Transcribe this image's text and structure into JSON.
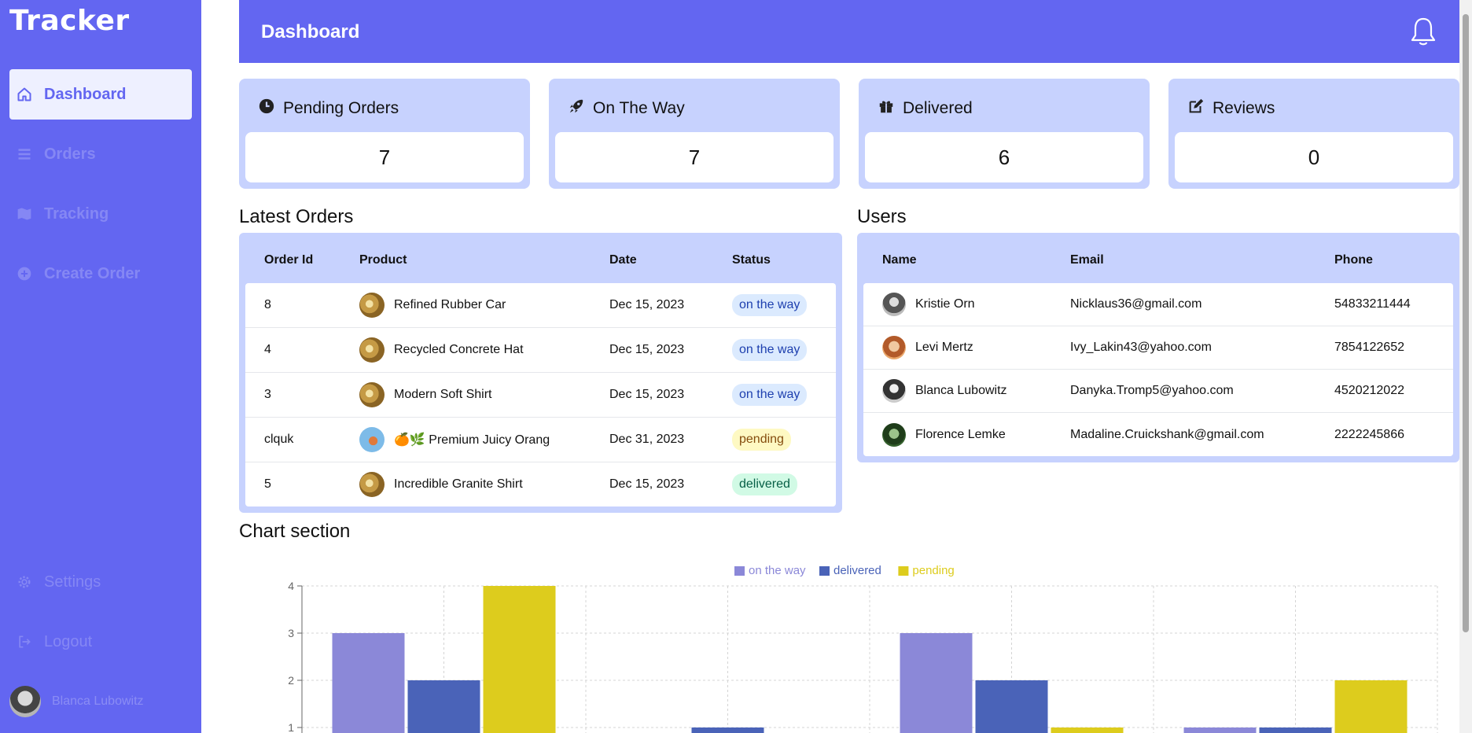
{
  "app": {
    "brand": "Tracker"
  },
  "sidebar": {
    "items": [
      {
        "label": "Dashboard",
        "icon": "home-icon",
        "active": true
      },
      {
        "label": "Orders",
        "icon": "list-icon",
        "active": false
      },
      {
        "label": "Tracking",
        "icon": "map-icon",
        "active": false
      },
      {
        "label": "Create Order",
        "icon": "plus-circle-icon",
        "active": false
      }
    ],
    "bottom_items": [
      {
        "label": "Settings",
        "icon": "gear-icon"
      },
      {
        "label": "Logout",
        "icon": "logout-icon"
      }
    ],
    "user": {
      "name": "Blanca Lubowitz"
    }
  },
  "header": {
    "title": "Dashboard",
    "icon": "bell-icon"
  },
  "stats": [
    {
      "label": "Pending Orders",
      "value": "7",
      "icon": "clock-icon"
    },
    {
      "label": "On The Way",
      "value": "7",
      "icon": "rocket-icon"
    },
    {
      "label": "Delivered",
      "value": "6",
      "icon": "gift-icon"
    },
    {
      "label": "Reviews",
      "value": "0",
      "icon": "edit-icon"
    }
  ],
  "orders": {
    "title": "Latest Orders",
    "columns": [
      "Order Id",
      "Product",
      "Date",
      "Status"
    ],
    "rows": [
      {
        "id": "8",
        "product": "Refined Rubber Car",
        "date": "Dec 15, 2023",
        "status": "on the way",
        "status_kind": "way",
        "thumb": "gold"
      },
      {
        "id": "4",
        "product": "Recycled Concrete Hat",
        "date": "Dec 15, 2023",
        "status": "on the way",
        "status_kind": "way",
        "thumb": "gold"
      },
      {
        "id": "3",
        "product": "Modern Soft Shirt",
        "date": "Dec 15, 2023",
        "status": "on the way",
        "status_kind": "way",
        "thumb": "gold"
      },
      {
        "id": "clquk",
        "product": "🍊🌿 Premium Juicy Orang",
        "date": "Dec 31, 2023",
        "status": "pending",
        "status_kind": "pending",
        "thumb": "blue"
      },
      {
        "id": "5",
        "product": "Incredible Granite Shirt",
        "date": "Dec 15, 2023",
        "status": "delivered",
        "status_kind": "delivered",
        "thumb": "gold"
      }
    ]
  },
  "users": {
    "title": "Users",
    "columns": [
      "Name",
      "Email",
      "Phone"
    ],
    "rows": [
      {
        "name": "Kristie Orn",
        "email": "Nicklaus36@gmail.com",
        "phone": "54833211444",
        "avatar": "a1"
      },
      {
        "name": "Levi Mertz",
        "email": "Ivy_Lakin43@yahoo.com",
        "phone": "7854122652",
        "avatar": "a2"
      },
      {
        "name": "Blanca Lubowitz",
        "email": "Danyka.Tromp5@yahoo.com",
        "phone": "4520212022",
        "avatar": "a3"
      },
      {
        "name": "Florence Lemke",
        "email": "Madaline.Cruickshank@gmail.com",
        "phone": "2222245866",
        "avatar": "a4"
      }
    ]
  },
  "chart_section": {
    "title": "Chart section"
  },
  "chart_data": {
    "type": "bar",
    "categories": [
      "",
      "",
      "",
      ""
    ],
    "series": [
      {
        "name": "on the way",
        "color": "#8b88d8",
        "values": [
          3,
          0,
          3,
          1
        ]
      },
      {
        "name": "delivered",
        "color": "#4a63b8",
        "values": [
          2,
          1,
          2,
          1
        ]
      },
      {
        "name": "pending",
        "color": "#ddcc1d",
        "values": [
          4,
          0,
          1,
          2
        ]
      }
    ],
    "yticks": [
      "1",
      "2",
      "3",
      "4"
    ],
    "ylim": [
      0,
      4
    ],
    "grid": true,
    "legend_position": "top-center"
  }
}
